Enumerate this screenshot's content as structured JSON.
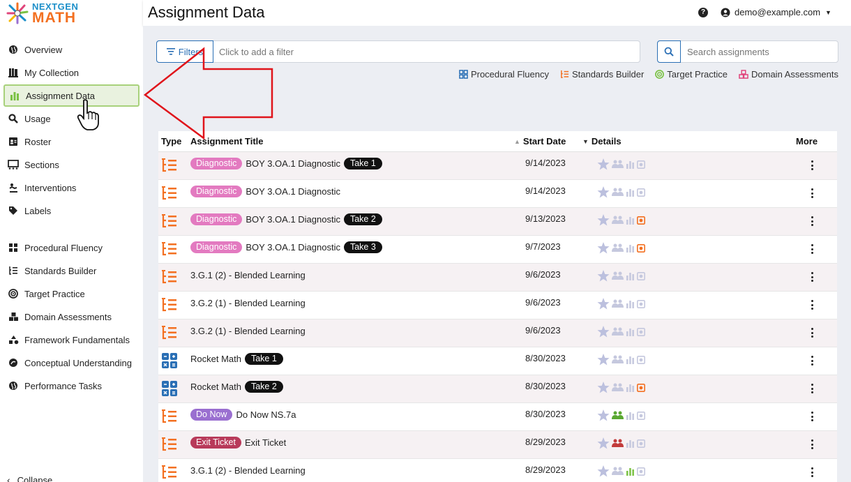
{
  "logo": {
    "top": "NEXTGEN",
    "bottom": "MATH"
  },
  "header": {
    "title": "Assignment Data",
    "help": "?",
    "user_email": "demo@example.com"
  },
  "sidebar": {
    "items": [
      {
        "label": "Overview",
        "icon": "globe-icon"
      },
      {
        "label": "My Collection",
        "icon": "collection-icon"
      },
      {
        "label": "Assignment Data",
        "icon": "bar-chart-icon",
        "active": true
      },
      {
        "label": "Usage",
        "icon": "magnifier-icon"
      },
      {
        "label": "Roster",
        "icon": "id-card-icon"
      },
      {
        "label": "Sections",
        "icon": "sections-icon"
      },
      {
        "label": "Interventions",
        "icon": "person-helping-icon"
      },
      {
        "label": "Labels",
        "icon": "tag-icon"
      },
      {
        "label": "Procedural Fluency",
        "icon": "grid-icon"
      },
      {
        "label": "Standards Builder",
        "icon": "list-icon"
      },
      {
        "label": "Target Practice",
        "icon": "target-icon"
      },
      {
        "label": "Domain Assessments",
        "icon": "cubes-icon"
      },
      {
        "label": "Framework Fundamentals",
        "icon": "shapes-icon"
      },
      {
        "label": "Conceptual Understanding",
        "icon": "brain-icon"
      },
      {
        "label": "Performance Tasks",
        "icon": "globe-icon"
      }
    ],
    "collapse_label": "Collapse"
  },
  "filters": {
    "button_label": "Filters",
    "placeholder": "Click to add a filter"
  },
  "search": {
    "placeholder": "Search assignments"
  },
  "legend": [
    {
      "label": "Procedural Fluency",
      "icon": "grid-icon",
      "color": "#2a6fb5"
    },
    {
      "label": "Standards Builder",
      "icon": "list-icon",
      "color": "#f37021"
    },
    {
      "label": "Target Practice",
      "icon": "target-icon",
      "color": "#7ac143"
    },
    {
      "label": "Domain Assessments",
      "icon": "cubes-icon",
      "color": "#e0457b"
    }
  ],
  "table": {
    "headers": {
      "type": "Type",
      "title": "Assignment Title",
      "start": "Start Date",
      "details": "Details",
      "more": "More"
    },
    "rows": [
      {
        "type": "standards",
        "tag": "Diagnostic",
        "tag_color": "#e37ac0",
        "title": "BOY 3.OA.1 Diagnostic",
        "take": "Take 1",
        "date": "9/14/2023",
        "group": "none",
        "chart": "none",
        "flag": "none"
      },
      {
        "type": "standards",
        "tag": "Diagnostic",
        "tag_color": "#e37ac0",
        "title": "BOY 3.OA.1 Diagnostic",
        "take": "",
        "date": "9/14/2023",
        "group": "none",
        "chart": "none",
        "flag": "none"
      },
      {
        "type": "standards",
        "tag": "Diagnostic",
        "tag_color": "#e37ac0",
        "title": "BOY 3.OA.1 Diagnostic",
        "take": "Take 2",
        "date": "9/13/2023",
        "group": "none",
        "chart": "none",
        "flag": "orange"
      },
      {
        "type": "standards",
        "tag": "Diagnostic",
        "tag_color": "#e37ac0",
        "title": "BOY 3.OA.1 Diagnostic",
        "take": "Take 3",
        "date": "9/7/2023",
        "group": "none",
        "chart": "none",
        "flag": "orange"
      },
      {
        "type": "standards",
        "tag": "",
        "tag_color": "",
        "title": "3.G.1 (2) - Blended Learning",
        "take": "",
        "date": "9/6/2023",
        "group": "none",
        "chart": "none",
        "flag": "none"
      },
      {
        "type": "standards",
        "tag": "",
        "tag_color": "",
        "title": "3.G.2 (1) - Blended Learning",
        "take": "",
        "date": "9/6/2023",
        "group": "none",
        "chart": "none",
        "flag": "none"
      },
      {
        "type": "standards",
        "tag": "",
        "tag_color": "",
        "title": "3.G.2 (1) - Blended Learning",
        "take": "",
        "date": "9/6/2023",
        "group": "none",
        "chart": "none",
        "flag": "none"
      },
      {
        "type": "procedural",
        "tag": "",
        "tag_color": "",
        "title": "Rocket Math",
        "take": "Take 1",
        "date": "8/30/2023",
        "group": "none",
        "chart": "none",
        "flag": "none"
      },
      {
        "type": "procedural",
        "tag": "",
        "tag_color": "",
        "title": "Rocket Math",
        "take": "Take 2",
        "date": "8/30/2023",
        "group": "none",
        "chart": "none",
        "flag": "orange"
      },
      {
        "type": "standards",
        "tag": "Do Now",
        "tag_color": "#9a6fd0",
        "title": "Do Now NS.7a",
        "take": "",
        "date": "8/30/2023",
        "group": "green",
        "chart": "none",
        "flag": "none"
      },
      {
        "type": "standards",
        "tag": "Exit Ticket",
        "tag_color": "#b83a5a",
        "title": "Exit Ticket",
        "take": "",
        "date": "8/29/2023",
        "group": "red",
        "chart": "none",
        "flag": "none"
      },
      {
        "type": "standards",
        "tag": "",
        "tag_color": "",
        "title": "3.G.1 (2) - Blended Learning",
        "take": "",
        "date": "8/29/2023",
        "group": "none",
        "chart": "green",
        "flag": "none"
      }
    ]
  }
}
